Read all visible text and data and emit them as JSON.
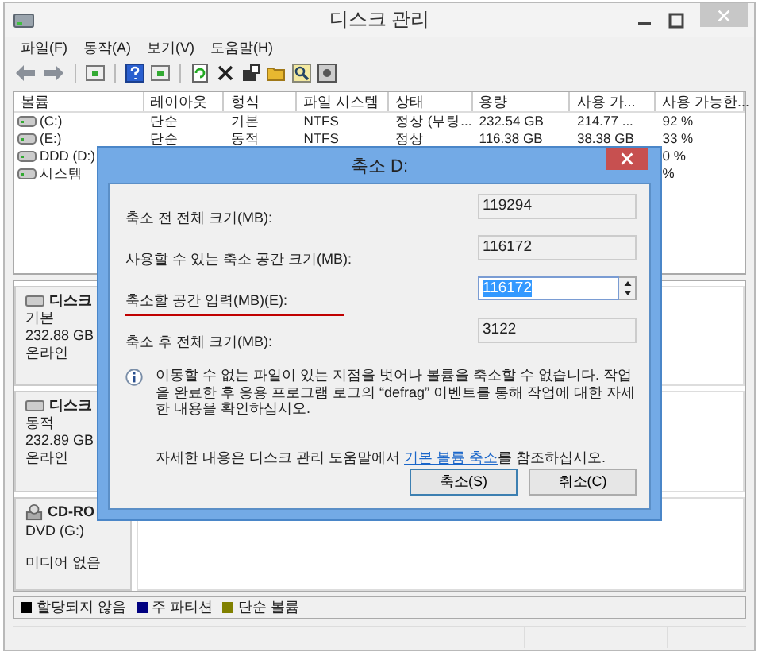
{
  "window": {
    "title": "디스크 관리"
  },
  "menu": [
    "파일(F)",
    "동작(A)",
    "보기(V)",
    "도움말(H)"
  ],
  "volumes": {
    "columns": [
      "볼륨",
      "레이아웃",
      "형식",
      "파일 시스템",
      "상태",
      "용량",
      "사용 가...",
      "사용 가능한..."
    ],
    "rows": [
      {
        "volume": "(C:)",
        "layout": "단순",
        "type": "기본",
        "file_system": "NTFS",
        "status": "정상 (부팅...",
        "capacity": "232.54 GB",
        "free_space": "214.77 ...",
        "free_pct": "92 %"
      },
      {
        "volume": "(E:)",
        "layout": "단순",
        "type": "동적",
        "file_system": "NTFS",
        "status": "정상",
        "capacity": "116.38 GB",
        "free_space": "38.38 GB",
        "free_pct": "33 %"
      },
      {
        "volume": "DDD (D:)",
        "free_pct": "0 %"
      },
      {
        "volume": "시스템",
        "free_pct": "%"
      }
    ]
  },
  "disks": [
    {
      "kind": "disk",
      "name": "디스크",
      "type": "기본",
      "size": "232.88 GB",
      "status": "온라인"
    },
    {
      "kind": "disk",
      "name": "디스크",
      "type": "동적",
      "size": "232.89 GB",
      "status": "온라인"
    },
    {
      "kind": "cdrom",
      "name": "CD-RO",
      "type": "DVD (G:)",
      "status": "미디어 없음"
    }
  ],
  "legend": [
    {
      "label": "할당되지 않음",
      "color": "#000000"
    },
    {
      "label": "주 파티션",
      "color": "#000080"
    },
    {
      "label": "단순 볼륨",
      "color": "#808000"
    }
  ],
  "dialog": {
    "title": "축소 D:",
    "fields": [
      {
        "kind": "readonly",
        "label": "축소 전 전체 크기(MB):",
        "value": "119294",
        "underlined": false,
        "value_selected": false
      },
      {
        "kind": "readonly",
        "label": "사용할 수 있는 축소 공간 크기(MB):",
        "value": "116172",
        "underlined": false,
        "value_selected": false
      },
      {
        "kind": "spin",
        "label": "축소할 공간 입력(MB)(E):",
        "value": "116172",
        "underlined": true,
        "value_selected": true
      },
      {
        "kind": "readonly",
        "label": "축소 후 전체 크기(MB):",
        "value": "3122",
        "underlined": false,
        "value_selected": false
      }
    ],
    "info": "이동할 수 없는 파일이 있는 지점을 벗어나 볼륨을 축소할 수 없습니다. 작업을 완료한 후 응용 프로그램 로그의 “defrag” 이벤트를 통해 작업에 대한 자세한 내용을 확인하십시오.",
    "help": {
      "before": "자세한 내용은 디스크 관리 도움말에서 ",
      "link": "기본 볼륨 축소",
      "after": "를 참조하십시오."
    },
    "buttons": [
      {
        "label": "축소(S)",
        "default": true
      },
      {
        "label": "취소(C)",
        "default": false
      }
    ]
  }
}
